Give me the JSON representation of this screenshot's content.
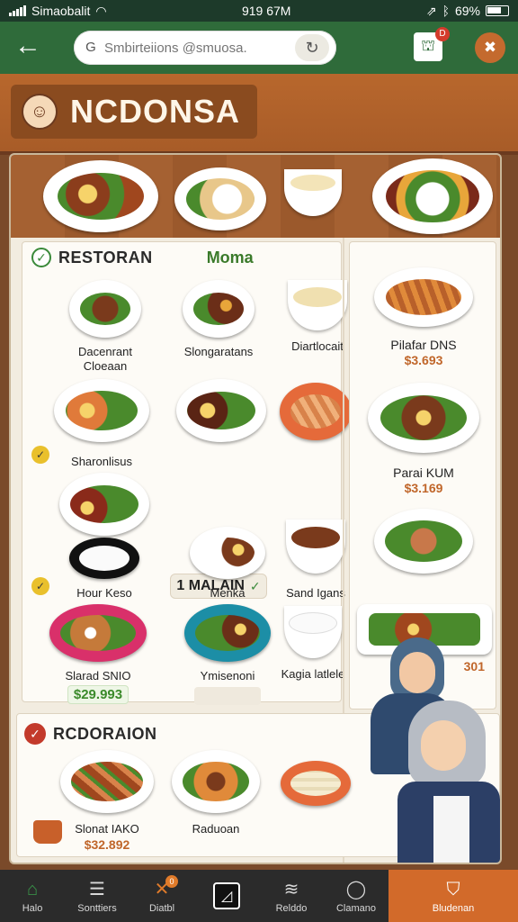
{
  "status_bar": {
    "carrier": "Simaobalit",
    "time": "919 67M",
    "battery": "69%"
  },
  "app_bar": {
    "search_placeholder": "Smbirteiions @smuosa.",
    "bag_badge": "D"
  },
  "hero": {
    "title": "NCDONSA"
  },
  "section_restoran": {
    "title": "RESTORAN",
    "accent": "Moma"
  },
  "grid_items": [
    {
      "label": "Dacenrant",
      "label2": "Cloeaan"
    },
    {
      "label": "Slongaratans"
    },
    {
      "label": "Diartlocait"
    },
    {
      "label": "Sharonlisus"
    },
    {
      "label": "Hour Keso"
    },
    {
      "label": "Menka"
    },
    {
      "label": "Sand Igans"
    },
    {
      "label": "Slarad SNIO",
      "price": "$29.993"
    },
    {
      "label": "Ymisenoni"
    },
    {
      "label": "Kagia latlele"
    }
  ],
  "malam_chip": "1 MALAIN",
  "right_items": [
    {
      "label": "Pilafar DNS",
      "price": "$3.693"
    },
    {
      "label": "Parai KUM",
      "price": "$3.169"
    },
    {
      "label": "",
      "price": "301"
    }
  ],
  "section_rcdoraion": {
    "title": "RCDORAION"
  },
  "bottom_items": [
    {
      "label": "Slonat IAKO",
      "price": "$32.892"
    },
    {
      "label": "Raduoan"
    }
  ],
  "nav": [
    {
      "label": "Halo",
      "icon": "home-icon"
    },
    {
      "label": "Sonttiers",
      "icon": "list-icon"
    },
    {
      "label": "Diatbl",
      "icon": "utensils-icon",
      "badge": "0"
    },
    {
      "label": "",
      "icon": "square-icon"
    },
    {
      "label": "Relddo",
      "icon": "stack-icon"
    },
    {
      "label": "Clamano",
      "icon": "chat-icon"
    },
    {
      "label": "Bludenan",
      "icon": "shield-icon",
      "active": true
    }
  ],
  "colors": {
    "brand_green": "#2f6b3a",
    "accent_orange": "#d26a2a",
    "wood": "#a56132",
    "price_orange": "#c0662a"
  }
}
